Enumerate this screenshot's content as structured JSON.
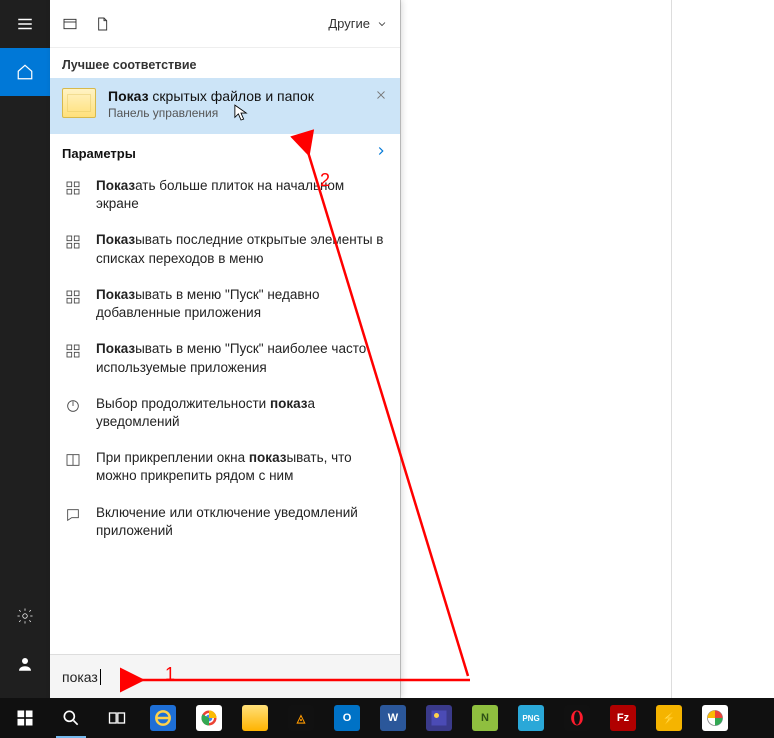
{
  "header": {
    "filter_label": "Другие"
  },
  "best_match": {
    "section_label": "Лучшее соответствие",
    "title_bold": "Показ",
    "title_rest": " скрытых файлов и папок",
    "subtitle": "Панель управления"
  },
  "parameters": {
    "section_label": "Параметры",
    "items": [
      {
        "bold": "Показ",
        "rest": "ать больше плиток на начальном экране",
        "icon": "tiles"
      },
      {
        "bold": "Показ",
        "rest": "ывать последние открытые элементы в списках переходов в меню",
        "icon": "tiles"
      },
      {
        "bold": "Показ",
        "rest": "ывать в меню \"Пуск\" недавно добавленные приложения",
        "icon": "tiles"
      },
      {
        "bold": "Показ",
        "rest": "ывать в меню \"Пуск\" наиболее часто используемые приложения",
        "icon": "tiles"
      },
      {
        "pre": "Выбор продолжительности ",
        "bold": "показ",
        "rest": "а уведомлений",
        "icon": "power"
      },
      {
        "pre": "При прикреплении окна ",
        "bold": "показ",
        "rest": "ывать, что можно прикрепить рядом с ним",
        "icon": "snap"
      },
      {
        "pre": "Включение или отключение уведомлений приложений",
        "bold": "",
        "rest": "",
        "icon": "chat"
      }
    ]
  },
  "search": {
    "value": "показ"
  },
  "annotations": {
    "step1": "1",
    "step2": "2"
  },
  "taskbar_apps": [
    "start",
    "search",
    "taskview",
    "ie",
    "chrome",
    "explorer",
    "aimp",
    "outlook",
    "word",
    "paintnet",
    "npp",
    "png",
    "opera",
    "filezilla",
    "amp",
    "picasa"
  ]
}
